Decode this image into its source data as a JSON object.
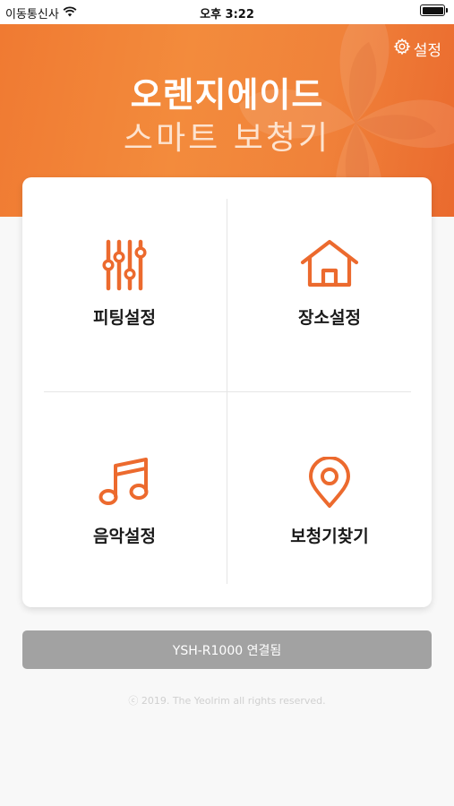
{
  "status_bar": {
    "carrier": "이동통신사",
    "time": "오후 3:22",
    "icons": [
      "wifi-icon",
      "battery-icon"
    ]
  },
  "header": {
    "settings_label": "설정",
    "title": "오렌지에이드",
    "subtitle": "스마트 보청기"
  },
  "menu": {
    "items": [
      {
        "label": "피팅설정",
        "icon": "sliders-icon"
      },
      {
        "label": "장소설정",
        "icon": "home-icon"
      },
      {
        "label": "음악설정",
        "icon": "music-note-icon"
      },
      {
        "label": "보청기찾기",
        "icon": "location-pin-icon"
      }
    ]
  },
  "connection": {
    "status_label": "YSH-R1000 연결됨"
  },
  "footer": {
    "copyright": "ⓒ 2019. The Yeolrim all rights reserved."
  },
  "colors": {
    "accent": "#f07a32",
    "icon": "#ec6a2e",
    "connect_bar": "#a2a2a2",
    "background": "#f8f8f8"
  }
}
